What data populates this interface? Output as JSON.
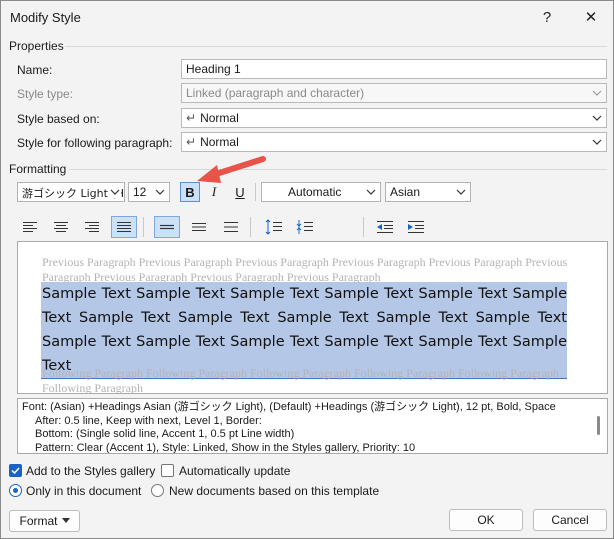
{
  "dialog": {
    "title": "Modify Style",
    "help_icon": "?",
    "close_icon": "✕"
  },
  "properties": {
    "section": "Properties",
    "name_label": "Name:",
    "name_value": "Heading 1",
    "style_type_label": "Style type:",
    "style_type_value": "Linked (paragraph and character)",
    "based_on_label": "Style based on:",
    "based_on_value": "Normal",
    "following_label": "Style for following paragraph:",
    "following_value": "Normal",
    "para_mark": "↵"
  },
  "formatting": {
    "section": "Formatting",
    "font": "游ゴシック Light (H",
    "size": "12",
    "bold": "B",
    "italic": "I",
    "underline": "U",
    "color": "Automatic",
    "script": "Asian"
  },
  "preview": {
    "previous": "Previous Paragraph Previous Paragraph Previous Paragraph Previous Paragraph Previous Paragraph Previous Paragraph Previous Paragraph Previous Paragraph Previous Paragraph",
    "sample": "Sample Text Sample Text Sample Text Sample Text Sample Text Sample Text Sample Text Sample Text Sample Text Sample Text Sample Text Sample Text Sample Text Sample Text Sample Text Sample Text Sample Text",
    "following": "Following Paragraph Following Paragraph Following Paragraph Following Paragraph Following Paragraph Following Paragraph"
  },
  "description": {
    "line1": "Font: (Asian) +Headings Asian (游ゴシック Light), (Default) +Headings (游ゴシック Light), 12 pt, Bold, Space",
    "line2": "After:  0.5 line, Keep with next, Level 1, Border:",
    "line3": "Bottom: (Single solid line, Accent 1,  0.5 pt Line width)",
    "line4": "Pattern: Clear (Accent 1), Style: Linked, Show in the Styles gallery, Priority: 10"
  },
  "options": {
    "add_to_gallery": "Add to the Styles gallery",
    "add_to_gallery_checked": true,
    "auto_update": "Automatically update",
    "auto_update_checked": false,
    "only_this_doc": "Only in this document",
    "new_docs": "New documents based on this template",
    "selected_scope": "only_this_doc"
  },
  "buttons": {
    "format": "Format",
    "ok": "OK",
    "cancel": "Cancel"
  },
  "colors": {
    "accent": "#1a63c4",
    "highlight": "#b4c7e7",
    "arrow": "#e8534a"
  }
}
